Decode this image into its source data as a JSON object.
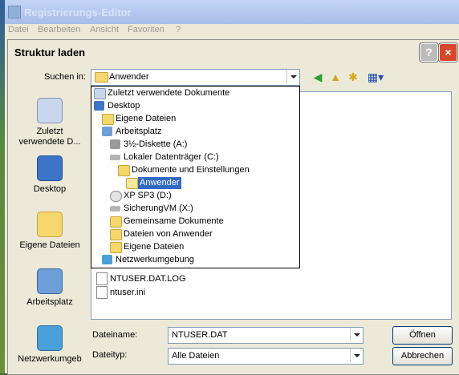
{
  "background_window": {
    "title": "Registrierungs-Editor",
    "menu": [
      "Datei",
      "Bearbeiten",
      "Ansicht",
      "Favoriten",
      "?"
    ]
  },
  "dialog": {
    "title": "Struktur laden",
    "help_label": "?",
    "close_label": "×",
    "look_in_label": "Suchen in:",
    "look_in_value": "Anwender",
    "places": [
      {
        "label": "Zuletzt verwendete D...",
        "icon": "recent-documents-icon"
      },
      {
        "label": "Desktop",
        "icon": "desktop-icon"
      },
      {
        "label": "Eigene Dateien",
        "icon": "my-documents-icon"
      },
      {
        "label": "Arbeitsplatz",
        "icon": "my-computer-icon"
      },
      {
        "label": "Netzwerkumgeb",
        "icon": "network-icon"
      }
    ],
    "dropdown": [
      {
        "label": "Zuletzt verwendete Dokumente",
        "icon": "recent-documents-icon"
      },
      {
        "label": "Desktop",
        "icon": "desktop-icon"
      },
      {
        "label": "Eigene Dateien",
        "icon": "folder-icon"
      },
      {
        "label": "Arbeitsplatz",
        "icon": "my-computer-icon"
      },
      {
        "label": "3½-Diskette (A:)",
        "icon": "floppy-icon"
      },
      {
        "label": "Lokaler Datenträger (C:)",
        "icon": "drive-icon"
      },
      {
        "label": "Dokumente und Einstellungen",
        "icon": "folder-icon"
      },
      {
        "label": "Anwender",
        "icon": "open-folder-icon"
      },
      {
        "label": "XP SP3 (D:)",
        "icon": "cd-icon"
      },
      {
        "label": "SicherungVM (X:)",
        "icon": "network-drive-icon"
      },
      {
        "label": "Gemeinsame Dokumente",
        "icon": "folder-icon"
      },
      {
        "label": "Dateien von Anwender",
        "icon": "folder-icon"
      },
      {
        "label": "Eigene Dateien",
        "icon": "folder-icon"
      },
      {
        "label": "Netzwerkumgebung",
        "icon": "network-icon"
      }
    ],
    "files": [
      "NTUSER.DAT.LOG",
      "ntuser.ini"
    ],
    "filename_label": "Dateiname:",
    "filename_value": "NTUSER.DAT",
    "filetype_label": "Dateityp:",
    "filetype_value": "Alle Dateien",
    "open_label": "Öffnen",
    "cancel_label": "Abbrechen"
  }
}
